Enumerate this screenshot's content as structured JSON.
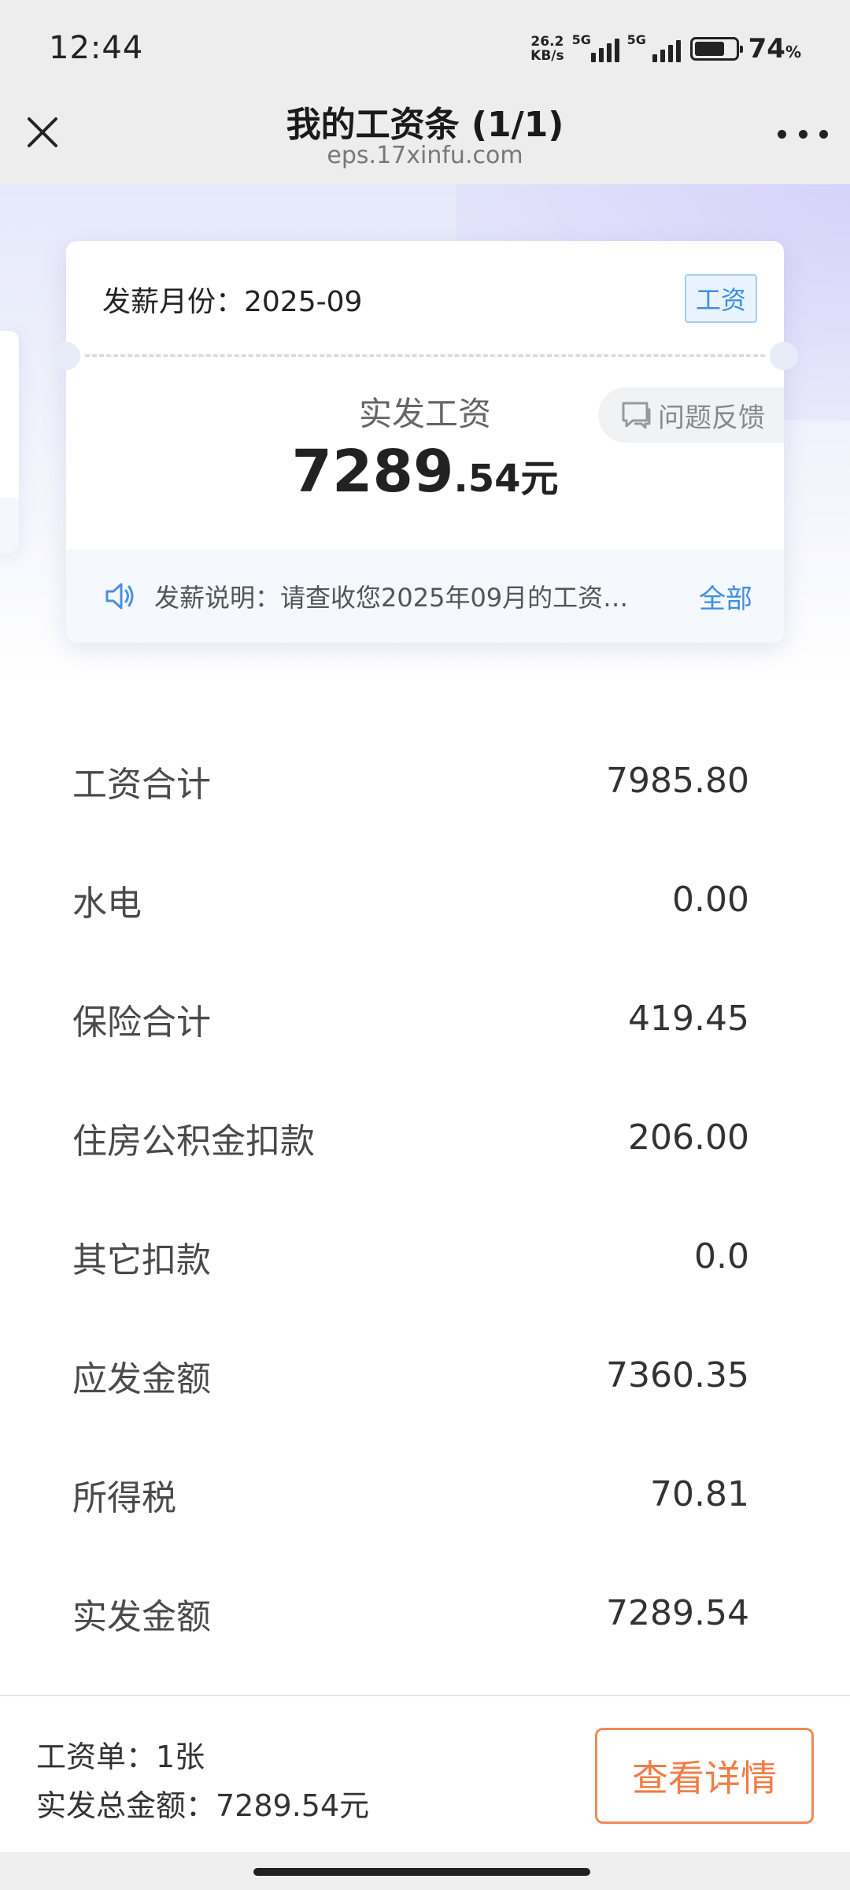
{
  "status_bar": {
    "time": "12:44",
    "net_speed_value": "26.2",
    "net_speed_unit": "KB/s",
    "sim1_tag": "5G",
    "sim2_tag": "5G",
    "battery_percent": "74",
    "battery_percent_unit": "%",
    "battery_level": 0.74
  },
  "nav": {
    "title": "我的工资条 (1/1)",
    "subtitle": "eps.17xinfu.com",
    "close_icon": "close-icon",
    "more_icon": "more-icon"
  },
  "card": {
    "month_label": "发薪月份：2025-09",
    "tag": "工资",
    "net_label": "实发工资",
    "net_amount_int": "7289",
    "net_amount_dec": ".54",
    "net_amount_unit": "元",
    "feedback_label": "问题反馈",
    "notice_text": "发薪说明：请查收您2025年09月的工资…",
    "notice_all": "全部"
  },
  "items": [
    {
      "label": "工资合计",
      "value": "7985.80"
    },
    {
      "label": "水电",
      "value": "0.00"
    },
    {
      "label": "保险合计",
      "value": "419.45"
    },
    {
      "label": "住房公积金扣款",
      "value": "206.00"
    },
    {
      "label": "其它扣款",
      "value": "0.0"
    },
    {
      "label": "应发金额",
      "value": "7360.35"
    },
    {
      "label": "所得税",
      "value": "70.81"
    },
    {
      "label": "实发金额",
      "value": "7289.54"
    }
  ],
  "footer": {
    "count_text": "工资单：1张",
    "total_text": "实发总金额：7289.54元",
    "detail_button": "查看详情"
  },
  "colors": {
    "accent_blue": "#3d8fe0",
    "accent_orange": "#ef7d45"
  }
}
